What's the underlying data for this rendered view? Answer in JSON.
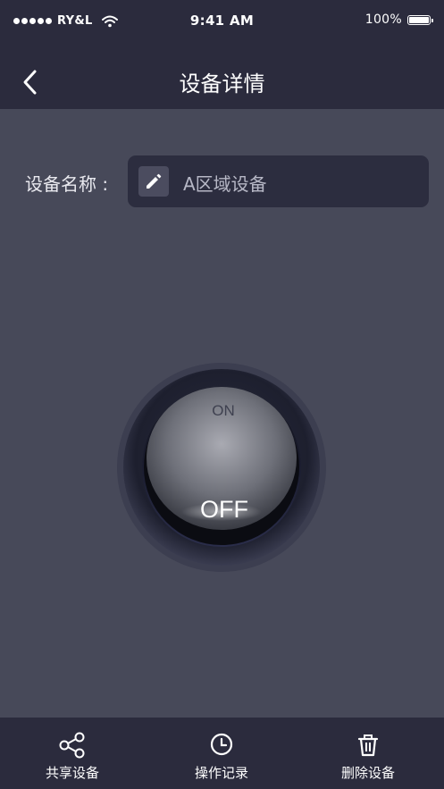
{
  "status_bar": {
    "carrier": "RY&L",
    "time": "9:41 AM",
    "battery": "100%"
  },
  "header": {
    "title": "设备详情"
  },
  "device": {
    "name_label": "设备名称 :",
    "name_value": "A区域设备"
  },
  "switch": {
    "on_label": "ON",
    "off_label": "OFF",
    "state": "OFF"
  },
  "tabbar": {
    "items": [
      {
        "label": "共享设备",
        "icon": "share-icon"
      },
      {
        "label": "操作记录",
        "icon": "clock-icon"
      },
      {
        "label": "删除设备",
        "icon": "trash-icon"
      }
    ]
  },
  "colors": {
    "background": "#474959",
    "bar": "#2b2b3d",
    "field": "#2c2d3f"
  }
}
